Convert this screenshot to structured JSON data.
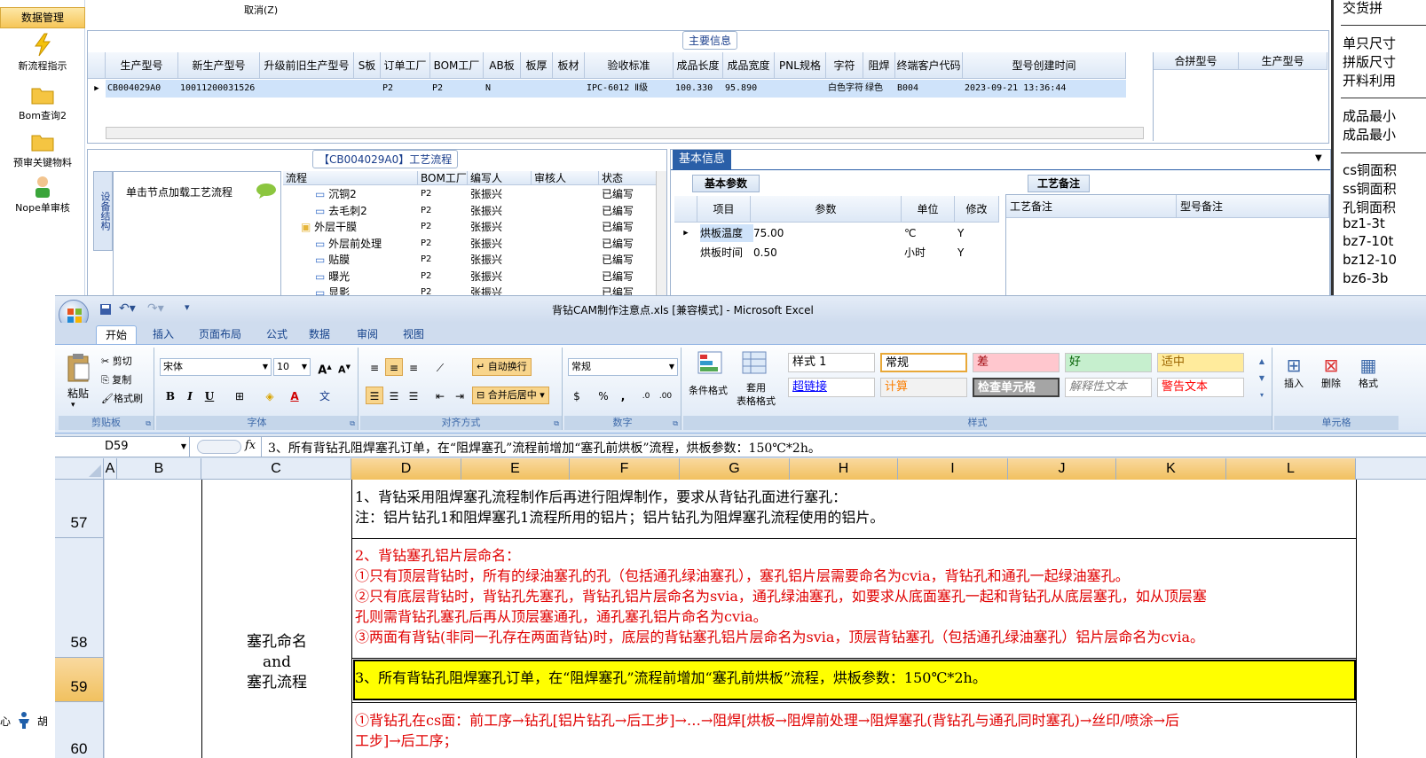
{
  "erp": {
    "left_panel": {
      "active_label": "数据管理",
      "top_label": "",
      "buttons": [
        {
          "label": "新流程指示",
          "icon": "lightning-icon"
        },
        {
          "label": "Bom查询2",
          "icon": "folder-icon"
        },
        {
          "label": "预审关键物料",
          "icon": "folder-icon"
        },
        {
          "label": "Nope单审核",
          "icon": "user-icon"
        }
      ],
      "bottom_labels": [
        "心",
        "胡"
      ]
    },
    "top_bar": {
      "cancel_label": "取消(Z)"
    },
    "right_panel": {
      "lines": [
        "交货拼",
        "单只尺寸",
        "拼版尺寸",
        "开料利用",
        "成品最小",
        "成品最小",
        "cs铜面积",
        "ss铜面积",
        "孔铜面积",
        "bz1-3t",
        "bz7-10t",
        "bz12-10",
        "bz6-3b"
      ]
    },
    "main_info": {
      "title": "主要信息",
      "headers": [
        "生产型号",
        "新生产型号",
        "升级前旧生产型号",
        "S板",
        "订单工厂",
        "BOM工厂",
        "AB板",
        "板厚",
        "板材",
        "验收标准",
        "成品长度",
        "成品宽度",
        "PNL规格",
        "字符",
        "阻焊",
        "终端客户代码",
        "型号创建时间"
      ],
      "row": [
        "CB004029A0",
        "10011200031526",
        "",
        "",
        "P2",
        "P2",
        "N",
        "",
        "",
        "IPC-6012 Ⅱ级",
        "100.330",
        "95.890",
        "",
        "白色字符",
        "绿色",
        "B004",
        "2023-09-21 13:36:44"
      ],
      "side_headers": [
        "合拼型号",
        "生产型号"
      ]
    },
    "process": {
      "title": "【CB004029A0】工艺流程",
      "vertical_tab": "设备结构",
      "load_label": "单击节点加载工艺流程",
      "headers": [
        "流程",
        "BOM工厂",
        "编写人",
        "审核人",
        "状态"
      ],
      "rows": [
        {
          "name": "沉铜2",
          "bom": "P2",
          "writer": "张振兴",
          "reviewer": "",
          "status": "已编写",
          "level": 2
        },
        {
          "name": "去毛刺2",
          "bom": "P2",
          "writer": "张振兴",
          "reviewer": "",
          "status": "已编写",
          "level": 2
        },
        {
          "name": "外层干膜",
          "bom": "P2",
          "writer": "张振兴",
          "reviewer": "",
          "status": "已编写",
          "level": 1
        },
        {
          "name": "外层前处理",
          "bom": "P2",
          "writer": "张振兴",
          "reviewer": "",
          "status": "已编写",
          "level": 2
        },
        {
          "name": "贴膜",
          "bom": "P2",
          "writer": "张振兴",
          "reviewer": "",
          "status": "已编写",
          "level": 2
        },
        {
          "name": "曝光",
          "bom": "P2",
          "writer": "张振兴",
          "reviewer": "",
          "status": "已编写",
          "level": 2
        },
        {
          "name": "显影",
          "bom": "P2",
          "writer": "张振兴",
          "reviewer": "",
          "status": "已编写",
          "level": 2
        }
      ]
    },
    "basic_info": {
      "tab": "基本信息",
      "sub_tab": "基本参数",
      "remark_tab": "工艺备注",
      "headers": [
        "项目",
        "参数",
        "单位",
        "修改"
      ],
      "rows": [
        {
          "item": "烘板温度",
          "param": "75.00",
          "unit": "℃",
          "edit": "Y"
        },
        {
          "item": "烘板时间",
          "param": "0.50",
          "unit": "小时",
          "edit": "Y"
        }
      ],
      "remark_headers": [
        "工艺备注",
        "型号备注"
      ]
    }
  },
  "excel": {
    "title": "背钻CAM制作注意点.xls  [兼容模式] - Microsoft Excel",
    "tabs": [
      "开始",
      "插入",
      "页面布局",
      "公式",
      "数据",
      "审阅",
      "视图"
    ],
    "ribbon": {
      "clipboard": {
        "paste": "粘贴",
        "cut": "剪切",
        "copy": "复制",
        "format_painter": "格式刷",
        "label": "剪贴板"
      },
      "font": {
        "name": "宋体",
        "size": "10",
        "label": "字体",
        "bold": "B",
        "italic": "I",
        "underline": "U"
      },
      "alignment": {
        "wrap": "自动换行",
        "merge": "合并后居中",
        "label": "对齐方式"
      },
      "number": {
        "format": "常规",
        "percent": "%",
        "comma": ",",
        "label": "数字"
      },
      "styles": {
        "cond_format": "条件格式",
        "table_format": "套用\n表格格式",
        "label": "样式",
        "cells": [
          {
            "text": "样式 1",
            "bg": "#ffffff",
            "fg": "#000000"
          },
          {
            "text": "常规",
            "bg": "#ffffff",
            "fg": "#000000"
          },
          {
            "text": "差",
            "bg": "#ffc7ce",
            "fg": "#9c0006"
          },
          {
            "text": "好",
            "bg": "#c6efce",
            "fg": "#006100"
          },
          {
            "text": "适中",
            "bg": "#ffeb9c",
            "fg": "#9c6500"
          },
          {
            "text": "超链接",
            "bg": "#ffffff",
            "fg": "#0000ff"
          },
          {
            "text": "计算",
            "bg": "#f2f2f2",
            "fg": "#fa7d00"
          },
          {
            "text": "检查单元格",
            "bg": "#a5a5a5",
            "fg": "#ffffff"
          },
          {
            "text": "解释性文本",
            "bg": "#ffffff",
            "fg": "#7f7f7f"
          },
          {
            "text": "警告文本",
            "bg": "#ffffff",
            "fg": "#ff0000"
          }
        ]
      },
      "cells_group": {
        "insert": "插入",
        "delete": "删除",
        "format": "格式",
        "label": "单元格"
      }
    },
    "name_box": "D59",
    "fx": "fx",
    "formula": "3、所有背钻孔阻焊塞孔订单，在“阻焊塞孔”流程前增加“塞孔前烘板”流程，烘板参数：150℃*2h。",
    "columns": [
      "A",
      "B",
      "C",
      "D",
      "E",
      "F",
      "G",
      "H",
      "I",
      "J",
      "K",
      "L"
    ],
    "rows": [
      {
        "num": "57",
        "lines": [
          "1、背钻采用阻焊塞孔流程制作后再进行阻焊制作，要求从背钻孔面进行塞孔：",
          "    注：铝片钻孔1和阻焊塞孔1流程所用的铝片；铝片钻孔为阻焊塞孔流程使用的铝片。"
        ]
      },
      {
        "num": "58",
        "lines": [
          "2、背钻塞孔铝片层命名：",
          "①只有顶层背钻时，所有的绿油塞孔的孔（包括通孔绿油塞孔），塞孔铝片层需要命名为cvia，背钻孔和通孔一起绿油塞孔。",
          "②只有底层背钻时，背钻孔先塞孔，背钻孔铝片层命名为svia，通孔绿油塞孔，如要求从底面塞孔一起和背钻孔从底层塞孔，如从顶层塞",
          "孔则需背钻孔塞孔后再从顶层塞通孔，通孔塞孔铝片命名为cvia。",
          "③两面有背钻(非同一孔存在两面背钻)时，底层的背钻塞孔铝片层命名为svia，顶层背钻塞孔（包括通孔绿油塞孔）铝片层命名为cvia。"
        ]
      },
      {
        "num": "59",
        "lines": [
          "3、所有背钻孔阻焊塞孔订单，在“阻焊塞孔”流程前增加“塞孔前烘板”流程，烘板参数：150℃*2h。"
        ]
      },
      {
        "num": "60",
        "lines": [
          "①背钻孔在cs面：前工序→钻孔[铝片钻孔→后工步]→…→阻焊[烘板→阻焊前处理→阻焊塞孔(背钻孔与通孔同时塞孔)→丝印/喷涂→后",
          "工步]→后工序；"
        ]
      }
    ],
    "merged_c": [
      "塞孔命名",
      "and",
      "塞孔流程"
    ],
    "colors": {
      "highlight": "#ffff00",
      "red_text": "#e00000",
      "accent": "#15428b"
    }
  }
}
